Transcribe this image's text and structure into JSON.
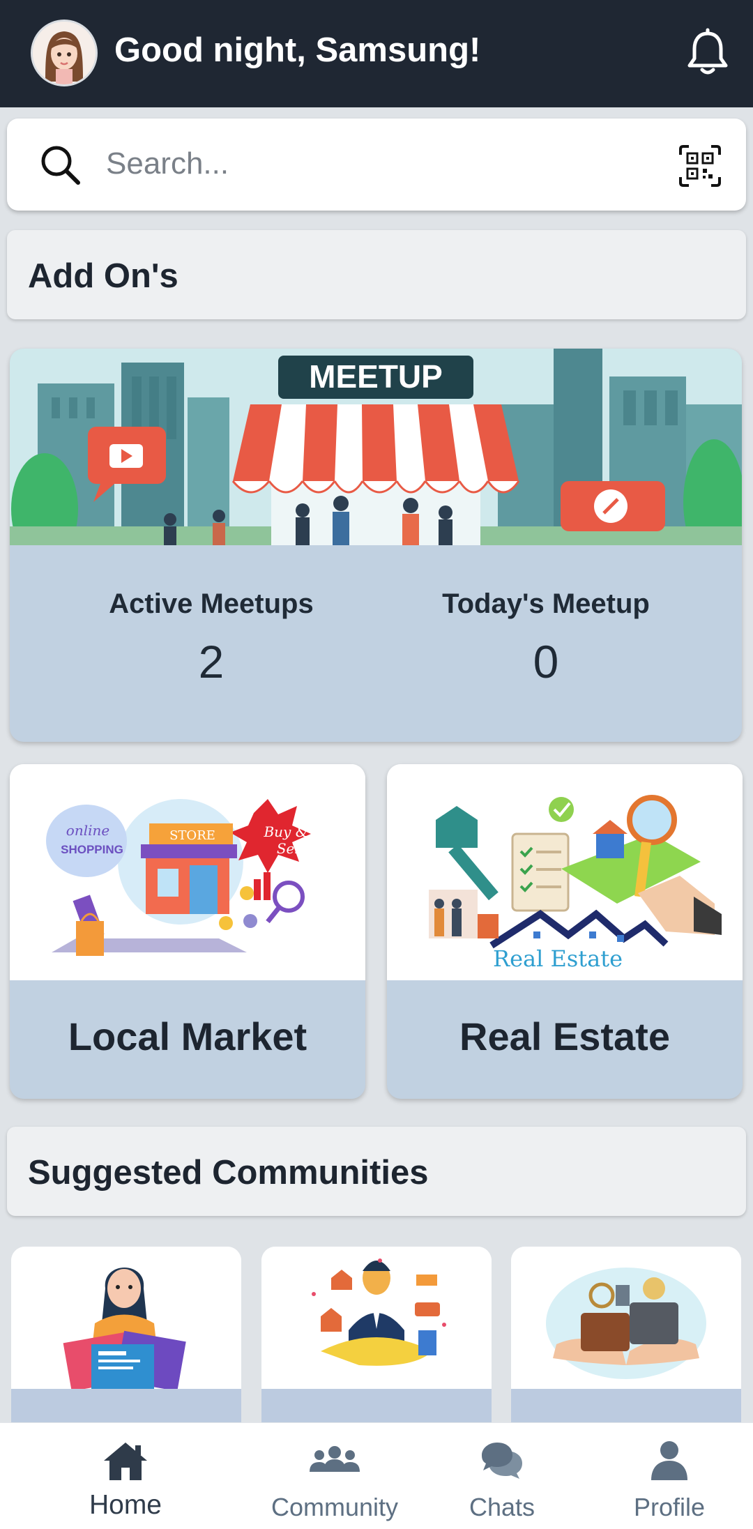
{
  "header": {
    "greeting": "Good night, Samsung!"
  },
  "search": {
    "placeholder": "Search..."
  },
  "addons": {
    "title": "Add On's",
    "meetup": {
      "banner_text": "MEETUP",
      "active_label": "Active Meetups",
      "active_value": "2",
      "today_label": "Today's Meetup",
      "today_value": "0"
    },
    "tiles": [
      {
        "label": "Local Market",
        "img_text_1": "online",
        "img_text_2": "SHOPPING",
        "img_text_3": "STORE",
        "img_text_4": "Buy &",
        "img_text_5": "Sell"
      },
      {
        "label": "Real Estate",
        "img_text": "Real Estate"
      }
    ]
  },
  "communities": {
    "title": "Suggested Communities"
  },
  "nav": {
    "items": [
      {
        "label": "Home",
        "icon": "home-icon",
        "active": true
      },
      {
        "label": "Community",
        "icon": "community-icon",
        "active": false
      },
      {
        "label": "Chats",
        "icon": "chats-icon",
        "active": false
      },
      {
        "label": "Profile",
        "icon": "profile-icon",
        "active": false
      }
    ]
  },
  "colors": {
    "header_bg": "#1f2733",
    "card_band": "#c1d1e1",
    "nav_inactive": "#5d6f82",
    "nav_active": "#2f3b4a"
  }
}
